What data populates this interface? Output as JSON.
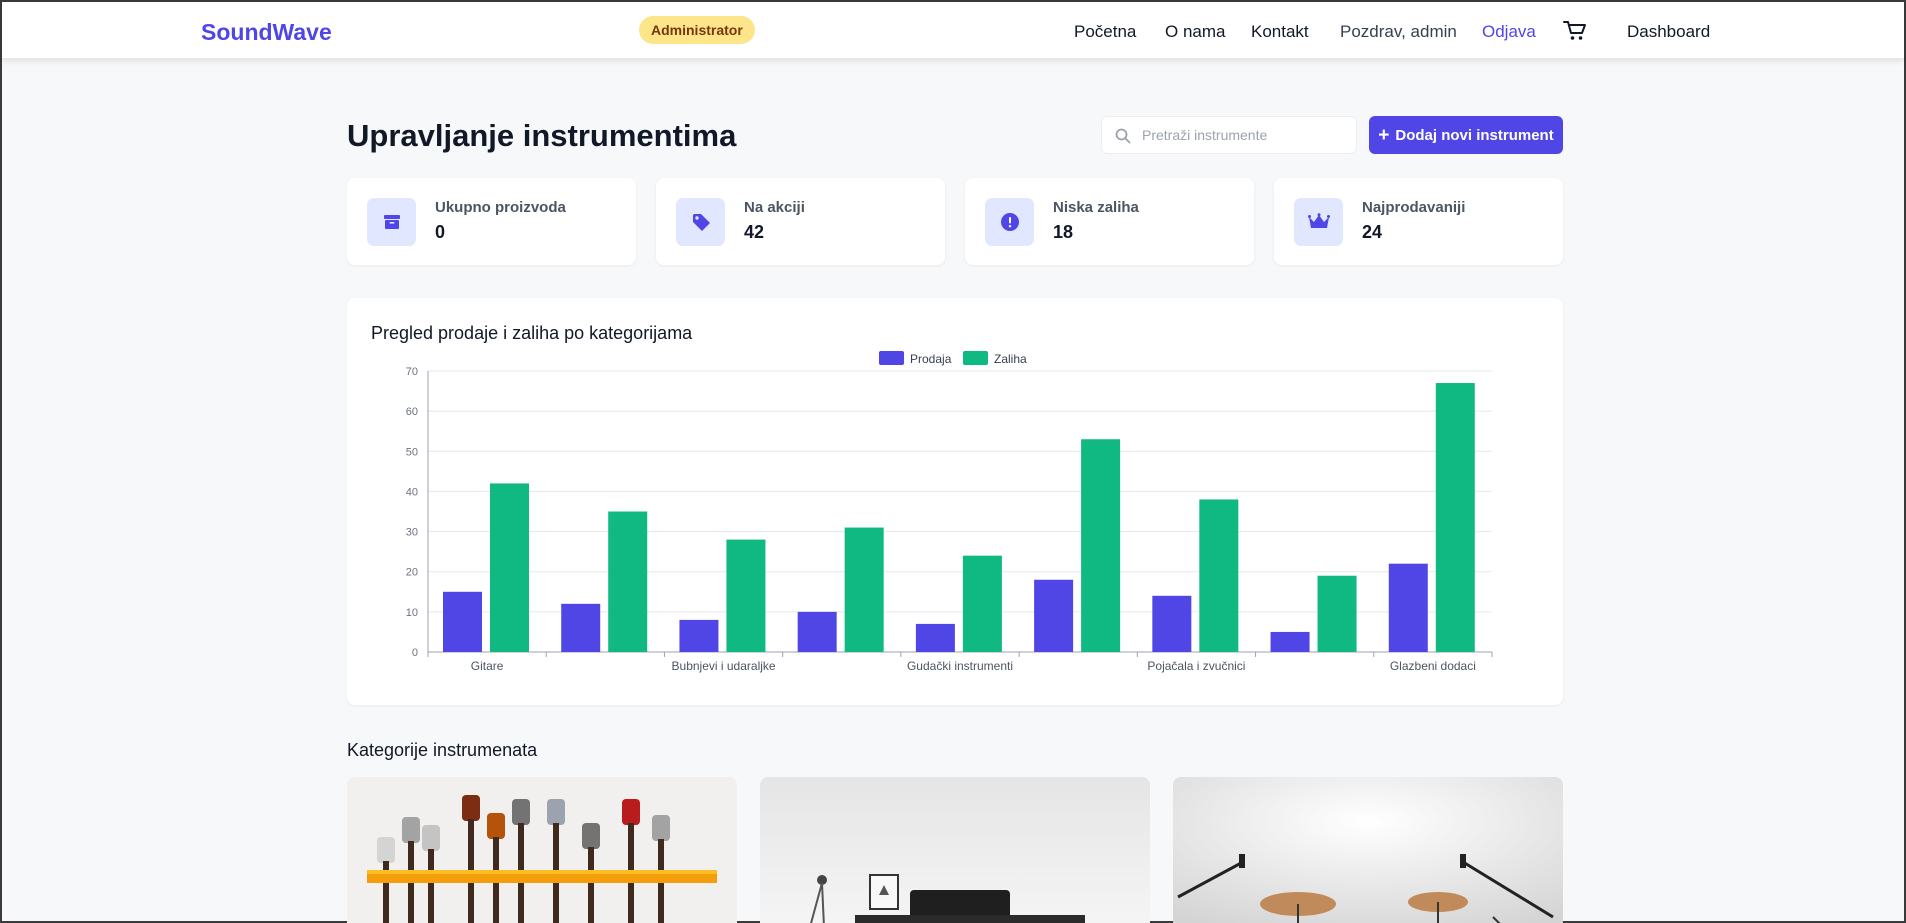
{
  "header": {
    "brand": "SoundWave",
    "role_badge": "Administrator",
    "nav": {
      "home": "Početna",
      "about": "O nama",
      "contact": "Kontakt",
      "greeting": "Pozdrav, admin",
      "logout": "Odjava",
      "dashboard": "Dashboard"
    },
    "icons": {
      "cart": "cart-icon"
    }
  },
  "main": {
    "title": "Upravljanje instrumentima",
    "search": {
      "placeholder": "Pretraži instrumente",
      "value": ""
    },
    "add_button": {
      "icon": "+",
      "label": "Dodaj novi instrument"
    },
    "stats": [
      {
        "label": "Ukupno proizvoda",
        "value": "0",
        "icon": "box-icon"
      },
      {
        "label": "Na akciji",
        "value": "42",
        "icon": "tag-icon"
      },
      {
        "label": "Niska zaliha",
        "value": "18",
        "icon": "alert-icon"
      },
      {
        "label": "Najprodavaniji",
        "value": "24",
        "icon": "crown-icon"
      }
    ],
    "section_title": "Kategorije instrumenata",
    "colors": {
      "accent": "#4f46e5",
      "stock": "#10b981",
      "badge": "#fde68a"
    }
  },
  "chart_data": {
    "type": "bar",
    "title": "Pregled prodaje i zaliha po kategorijama",
    "xlabel": "",
    "ylabel": "",
    "ylim": [
      0,
      70
    ],
    "yticks": [
      0,
      10,
      20,
      30,
      40,
      50,
      60,
      70
    ],
    "categories": [
      "Gitare",
      "",
      "Bubnjevi i udaraljke",
      "",
      "Gudački instrumenti",
      "",
      "Pojačala i zvučnici",
      "",
      "Glazbeni dodaci"
    ],
    "series": [
      {
        "name": "Prodaja",
        "color": "#4f46e5",
        "values": [
          15,
          12,
          8,
          10,
          7,
          18,
          14,
          5,
          22
        ]
      },
      {
        "name": "Zaliha",
        "color": "#10b981",
        "values": [
          42,
          35,
          28,
          31,
          24,
          53,
          38,
          19,
          67
        ]
      }
    ],
    "legend": "top-center",
    "grid": true
  }
}
